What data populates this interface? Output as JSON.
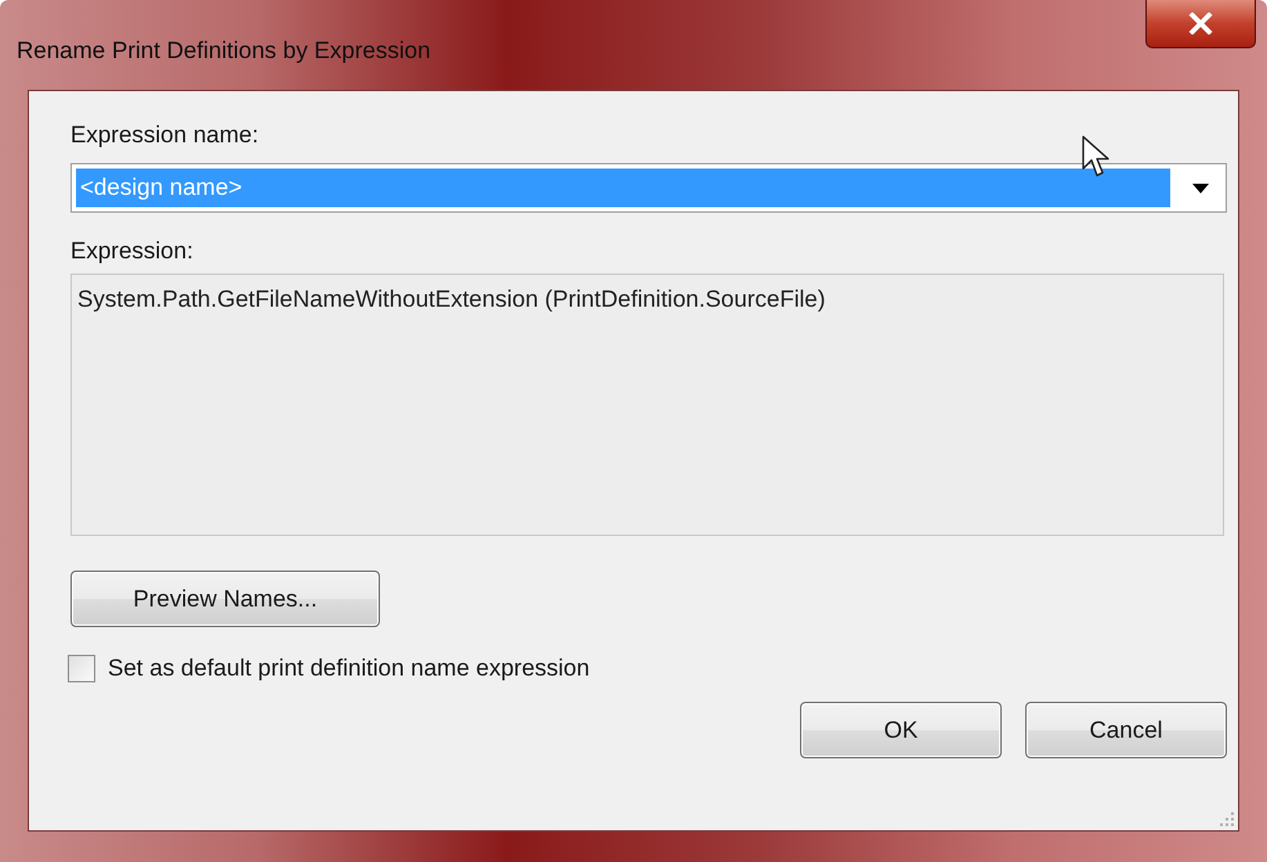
{
  "window": {
    "title": "Rename Print Definitions by Expression"
  },
  "expression_name": {
    "label": "Expression name:",
    "value": "<design name>",
    "selected": true
  },
  "expression": {
    "label": "Expression:",
    "value": "System.Path.GetFileNameWithoutExtension (PrintDefinition.SourceFile)"
  },
  "preview_button": "Preview Names...",
  "default_checkbox": {
    "label": "Set as default print definition name expression",
    "checked": false
  },
  "buttons": [
    "OK",
    "Cancel"
  ]
}
